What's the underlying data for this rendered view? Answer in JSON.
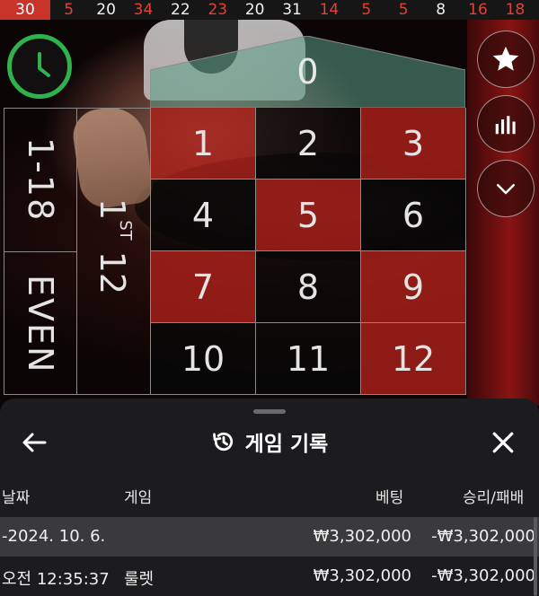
{
  "history": {
    "first": "30",
    "numbers": [
      {
        "value": "5",
        "color": "red"
      },
      {
        "value": "20",
        "color": "black"
      },
      {
        "value": "34",
        "color": "red"
      },
      {
        "value": "22",
        "color": "black"
      },
      {
        "value": "23",
        "color": "red"
      },
      {
        "value": "20",
        "color": "black"
      },
      {
        "value": "31",
        "color": "black"
      },
      {
        "value": "14",
        "color": "red"
      },
      {
        "value": "5",
        "color": "red"
      },
      {
        "value": "5",
        "color": "red"
      },
      {
        "value": "8",
        "color": "black"
      },
      {
        "value": "16",
        "color": "red"
      },
      {
        "value": "18",
        "color": "red"
      }
    ]
  },
  "table": {
    "zero": "0",
    "cells": [
      {
        "n": "1",
        "c": "red"
      },
      {
        "n": "2",
        "c": "black"
      },
      {
        "n": "3",
        "c": "red"
      },
      {
        "n": "4",
        "c": "black"
      },
      {
        "n": "5",
        "c": "red"
      },
      {
        "n": "6",
        "c": "black"
      },
      {
        "n": "7",
        "c": "red"
      },
      {
        "n": "8",
        "c": "black"
      },
      {
        "n": "9",
        "c": "red"
      },
      {
        "n": "10",
        "c": "black"
      },
      {
        "n": "11",
        "c": "black"
      },
      {
        "n": "12",
        "c": "red"
      }
    ],
    "low": "1-18",
    "even": "EVEN",
    "dozen_number": "1",
    "dozen_suffix": "ST",
    "dozen_value": "12"
  },
  "icons": {
    "timer": "clock-icon",
    "favorite": "star-icon",
    "stats": "bar-chart-icon",
    "expand": "chevron-down-icon",
    "history": "history-icon",
    "back": "arrow-left-icon",
    "close": "close-icon"
  },
  "colors": {
    "timer_ring": "#2fb24b",
    "red_cell": "#aa201a",
    "zero_green": "#5aa08a",
    "sheet_bg": "#1c1c1e",
    "selected_row": "#3a3a3c"
  },
  "sheet": {
    "title": "게임 기록",
    "columns": {
      "date": "날짜",
      "game": "게임",
      "bet": "베팅",
      "win_loss": "승리/패배"
    },
    "rows": [
      {
        "date": "-2024. 10. 6.",
        "game": "",
        "bet": "₩3,302,000",
        "win_loss": "-₩3,302,000"
      },
      {
        "date": "오전 12:35:37",
        "game": "룰렛",
        "bet": "₩3,302,000",
        "win_loss": "-₩3,302,000"
      }
    ]
  }
}
